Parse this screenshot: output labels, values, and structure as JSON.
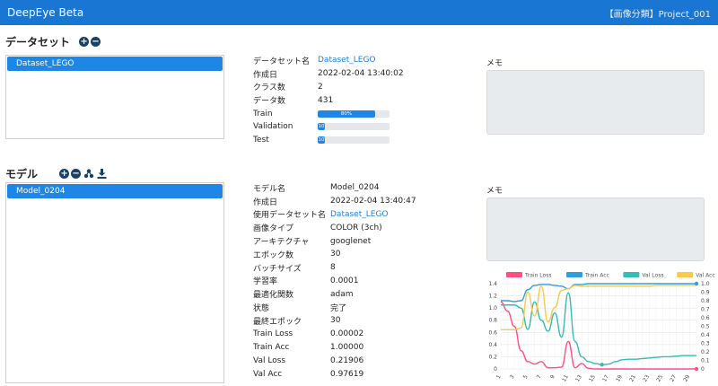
{
  "app": {
    "title": "DeepEye Beta",
    "project": "【画像分類】Project_001"
  },
  "dataset_section": {
    "title": "データセット",
    "items": [
      {
        "label": "Dataset_LEGO"
      }
    ],
    "details": [
      {
        "key": "データセット名",
        "value": "Dataset_LEGO",
        "link": true
      },
      {
        "key": "作成日",
        "value": "2022-02-04 13:40:02"
      },
      {
        "key": "クラス数",
        "value": "2"
      },
      {
        "key": "データ数",
        "value": "431"
      }
    ],
    "splits": [
      {
        "key": "Train",
        "label": "80%",
        "fraction": 0.8
      },
      {
        "key": "Validation",
        "label": "10",
        "fraction": 0.1
      },
      {
        "key": "Test",
        "label": "10",
        "fraction": 0.1
      }
    ],
    "memo_label": "メモ"
  },
  "model_section": {
    "title": "モデル",
    "items": [
      {
        "label": "Model_0204"
      }
    ],
    "details": [
      {
        "key": "モデル名",
        "value": "Model_0204"
      },
      {
        "key": "作成日",
        "value": "2022-02-04 13:40:47"
      },
      {
        "key": "使用データセット名",
        "value": "Dataset_LEGO",
        "link": true
      },
      {
        "key": "画像タイプ",
        "value": "COLOR (3ch)"
      },
      {
        "key": "アーキテクチャ",
        "value": "googlenet"
      },
      {
        "key": "エポック数",
        "value": "30"
      },
      {
        "key": "バッチサイズ",
        "value": "8"
      },
      {
        "key": "学習率",
        "value": "0.0001"
      },
      {
        "key": "最適化関数",
        "value": "adam"
      },
      {
        "key": "状態",
        "value": "完了"
      },
      {
        "key": "最終エポック",
        "value": "30"
      },
      {
        "key": "Train Loss",
        "value": "0.00002"
      },
      {
        "key": "Train Acc",
        "value": "1.00000"
      },
      {
        "key": "Val Loss",
        "value": "0.21906"
      },
      {
        "key": "Val Acc",
        "value": "0.97619"
      }
    ],
    "memo_label": "メモ"
  },
  "colors": {
    "accent": "#1976d2",
    "train_loss": "#ff4f80",
    "train_acc": "#2d9fe0",
    "val_loss": "#35bcb4",
    "val_acc": "#f9c94a"
  },
  "chart_data": {
    "type": "line",
    "x": [
      1,
      2,
      3,
      4,
      5,
      6,
      7,
      8,
      9,
      10,
      11,
      12,
      13,
      14,
      15,
      16,
      17,
      18,
      19,
      20,
      21,
      22,
      23,
      24,
      25,
      26,
      27,
      28,
      29,
      30
    ],
    "x_tick_labels": [
      "1",
      "3",
      "5",
      "7",
      "9",
      "11",
      "13",
      "15",
      "17",
      "19",
      "21",
      "23",
      "25",
      "27",
      "29"
    ],
    "y_left_ticks": [
      "0",
      "0.2",
      "0.4",
      "0.6",
      "0.8",
      "1.0",
      "1.2",
      "1.4"
    ],
    "y_right_ticks": [
      "0",
      "0.1",
      "0.2",
      "0.3",
      "0.4",
      "0.5",
      "0.6",
      "0.7",
      "0.8",
      "0.9",
      "1.0"
    ],
    "ylim_left": [
      0,
      1.4
    ],
    "ylim_right": [
      0,
      1.0
    ],
    "grid": true,
    "legend": "top",
    "series": [
      {
        "name": "Train Loss",
        "axis": "left",
        "color": "#ff4f80",
        "values": [
          1.1,
          0.95,
          0.7,
          0.3,
          0.12,
          0.08,
          0.12,
          0.02,
          0.02,
          0.03,
          0.45,
          0.02,
          0.09,
          0.01,
          0.0,
          0.0,
          0.0,
          0.0,
          0.0,
          0.0,
          0.0,
          0.0,
          0.0,
          0.0,
          0.0,
          0.0,
          0.0,
          0.0,
          0.0,
          0.0
        ]
      },
      {
        "name": "Train Acc",
        "axis": "right",
        "color": "#2d9fe0",
        "values": [
          0.8,
          0.8,
          0.79,
          0.8,
          0.93,
          0.98,
          0.99,
          0.99,
          0.98,
          0.97,
          0.94,
          0.99,
          0.99,
          1.0,
          1.0,
          1.0,
          1.0,
          1.0,
          1.0,
          1.0,
          1.0,
          1.0,
          1.0,
          1.0,
          1.0,
          1.0,
          1.0,
          1.0,
          1.0,
          1.0
        ]
      },
      {
        "name": "Val Loss",
        "axis": "left",
        "color": "#35bcb4",
        "values": [
          1.05,
          1.05,
          1.05,
          1.0,
          0.65,
          1.1,
          0.8,
          0.62,
          0.92,
          0.52,
          1.25,
          0.45,
          0.2,
          0.12,
          0.09,
          0.07,
          0.08,
          0.12,
          0.15,
          0.16,
          0.16,
          0.17,
          0.18,
          0.19,
          0.2,
          0.2,
          0.21,
          0.22,
          0.22,
          0.22
        ]
      },
      {
        "name": "Val Acc",
        "axis": "right",
        "color": "#f9c94a",
        "values": [
          0.46,
          0.46,
          0.46,
          0.48,
          0.9,
          0.62,
          0.97,
          0.55,
          0.72,
          0.92,
          0.94,
          0.98,
          0.97,
          0.97,
          0.97,
          0.97,
          0.97,
          0.97,
          0.97,
          0.97,
          0.97,
          0.97,
          0.97,
          0.98,
          0.98,
          0.98,
          0.98,
          0.98,
          0.98,
          0.98
        ]
      }
    ]
  }
}
